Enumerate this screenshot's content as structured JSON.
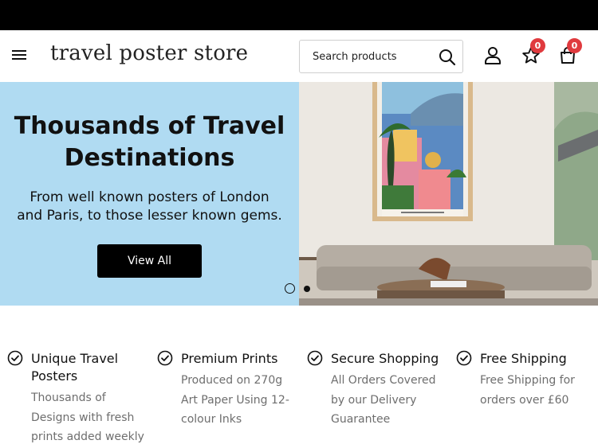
{
  "header": {
    "logo": "travel poster store",
    "search_placeholder": "Search products",
    "wishlist_count": "0",
    "cart_count": "0"
  },
  "hero": {
    "title": "Thousands of Travel Destinations",
    "subtitle": "From well known posters of London and Paris, to those lesser known gems.",
    "button_label": "View All",
    "slide_count": 2,
    "active_slide": 1,
    "background_color": "#b0dbf2"
  },
  "features": [
    {
      "title": "Unique Travel Posters",
      "desc": "Thousands of Designs with fresh prints added weekly",
      "icon": "check-circle-icon"
    },
    {
      "title": "Premium Prints",
      "desc": "Produced on 270g Art Paper Using 12-colour Inks",
      "icon": "check-circle-icon"
    },
    {
      "title": "Secure Shopping",
      "desc": "All Orders Covered by our Delivery Guarantee",
      "icon": "check-circle-icon"
    },
    {
      "title": "Free Shipping",
      "desc": "Free Shipping for orders over £60",
      "icon": "check-circle-icon"
    }
  ],
  "colors": {
    "accent_badge": "#e03a3e",
    "hero_bg": "#b0dbf2",
    "button_bg": "#000000"
  },
  "icons": {
    "menu": "hamburger-icon",
    "search": "search-icon",
    "account": "user-icon",
    "wishlist": "star-icon",
    "cart": "shopping-bag-icon"
  }
}
